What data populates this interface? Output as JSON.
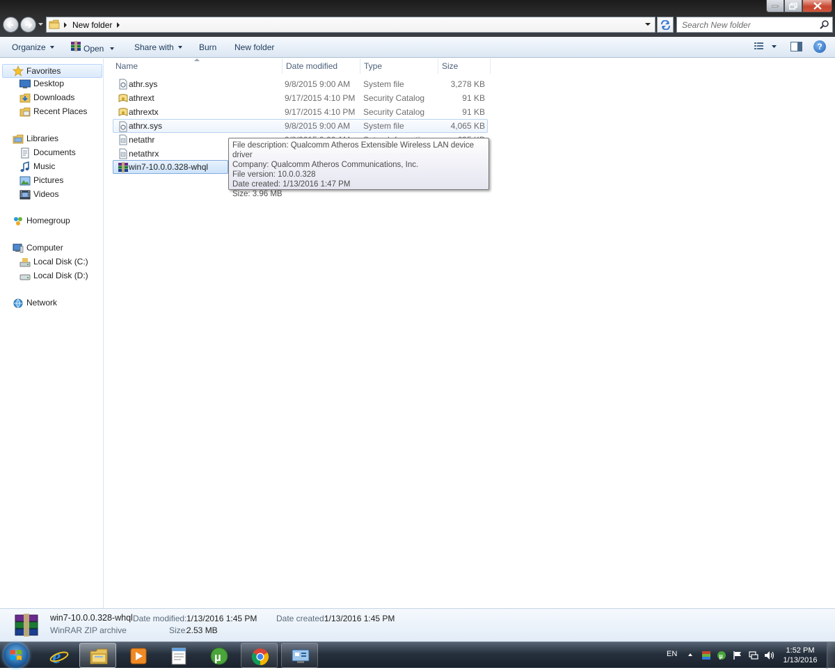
{
  "address": {
    "crumbs": [
      "New folder"
    ],
    "search_placeholder": "Search New folder"
  },
  "commandbar": {
    "organize": "Organize",
    "open": "Open",
    "share_with": "Share with",
    "burn": "Burn",
    "new_folder": "New folder"
  },
  "navpane": {
    "favorites": "Favorites",
    "desktop": "Desktop",
    "downloads": "Downloads",
    "recent_places": "Recent Places",
    "libraries": "Libraries",
    "documents": "Documents",
    "music": "Music",
    "pictures": "Pictures",
    "videos": "Videos",
    "homegroup": "Homegroup",
    "computer": "Computer",
    "local_disk_c": "Local Disk (C:)",
    "local_disk_d": "Local Disk (D:)",
    "network": "Network"
  },
  "columns": {
    "name": "Name",
    "date_modified": "Date modified",
    "type": "Type",
    "size": "Size"
  },
  "files": [
    {
      "name": "athr.sys",
      "date": "9/8/2015 9:00 AM",
      "type": "System file",
      "size": "3,278 KB",
      "icon": "sys-file-icon"
    },
    {
      "name": "athrext",
      "date": "9/17/2015 4:10 PM",
      "type": "Security Catalog",
      "size": "91 KB",
      "icon": "catalog-file-icon"
    },
    {
      "name": "athrextx",
      "date": "9/17/2015 4:10 PM",
      "type": "Security Catalog",
      "size": "91 KB",
      "icon": "catalog-file-icon"
    },
    {
      "name": "athrx.sys",
      "date": "9/8/2015 9:00 AM",
      "type": "System file",
      "size": "4,065 KB",
      "icon": "sys-file-icon"
    },
    {
      "name": "netathr",
      "date": "9/8/2015 9:00 AM",
      "type": "Setup Information",
      "size": "635 KB",
      "icon": "inf-file-icon"
    },
    {
      "name": "netathrx",
      "date": "",
      "type": "",
      "size": "",
      "icon": "inf-file-icon"
    },
    {
      "name": "win7-10.0.0.328-whql",
      "date": "",
      "type": "",
      "size": "",
      "icon": "winrar-archive-icon"
    }
  ],
  "tooltip": {
    "line1": "File description: Qualcomm Atheros Extensible Wireless LAN device driver",
    "line2": "Company: Qualcomm Atheros Communications, Inc.",
    "line3": "File version: 10.0.0.328",
    "line4": "Date created: 1/13/2016 1:47 PM",
    "line5": "Size: 3.96 MB"
  },
  "details": {
    "name": "win7-10.0.0.328-whql",
    "type": "WinRAR ZIP archive",
    "date_modified_label": "Date modified:",
    "date_modified": "1/13/2016 1:45 PM",
    "date_created_label": "Date created:",
    "date_created": "1/13/2016 1:45 PM",
    "size_label": "Size:",
    "size": "2.53 MB"
  },
  "taskbar": {
    "language": "EN",
    "time": "1:52 PM",
    "date": "1/13/2016",
    "apps": [
      "internet-explorer-icon",
      "windows-explorer-icon",
      "media-player-icon",
      "notepad-icon",
      "utorrent-icon",
      "chrome-icon",
      "remote-desktop-icon"
    ]
  },
  "colors": {
    "accent": "#1e395b",
    "selection": "#cce2fa",
    "taskbar": "#26303d"
  }
}
